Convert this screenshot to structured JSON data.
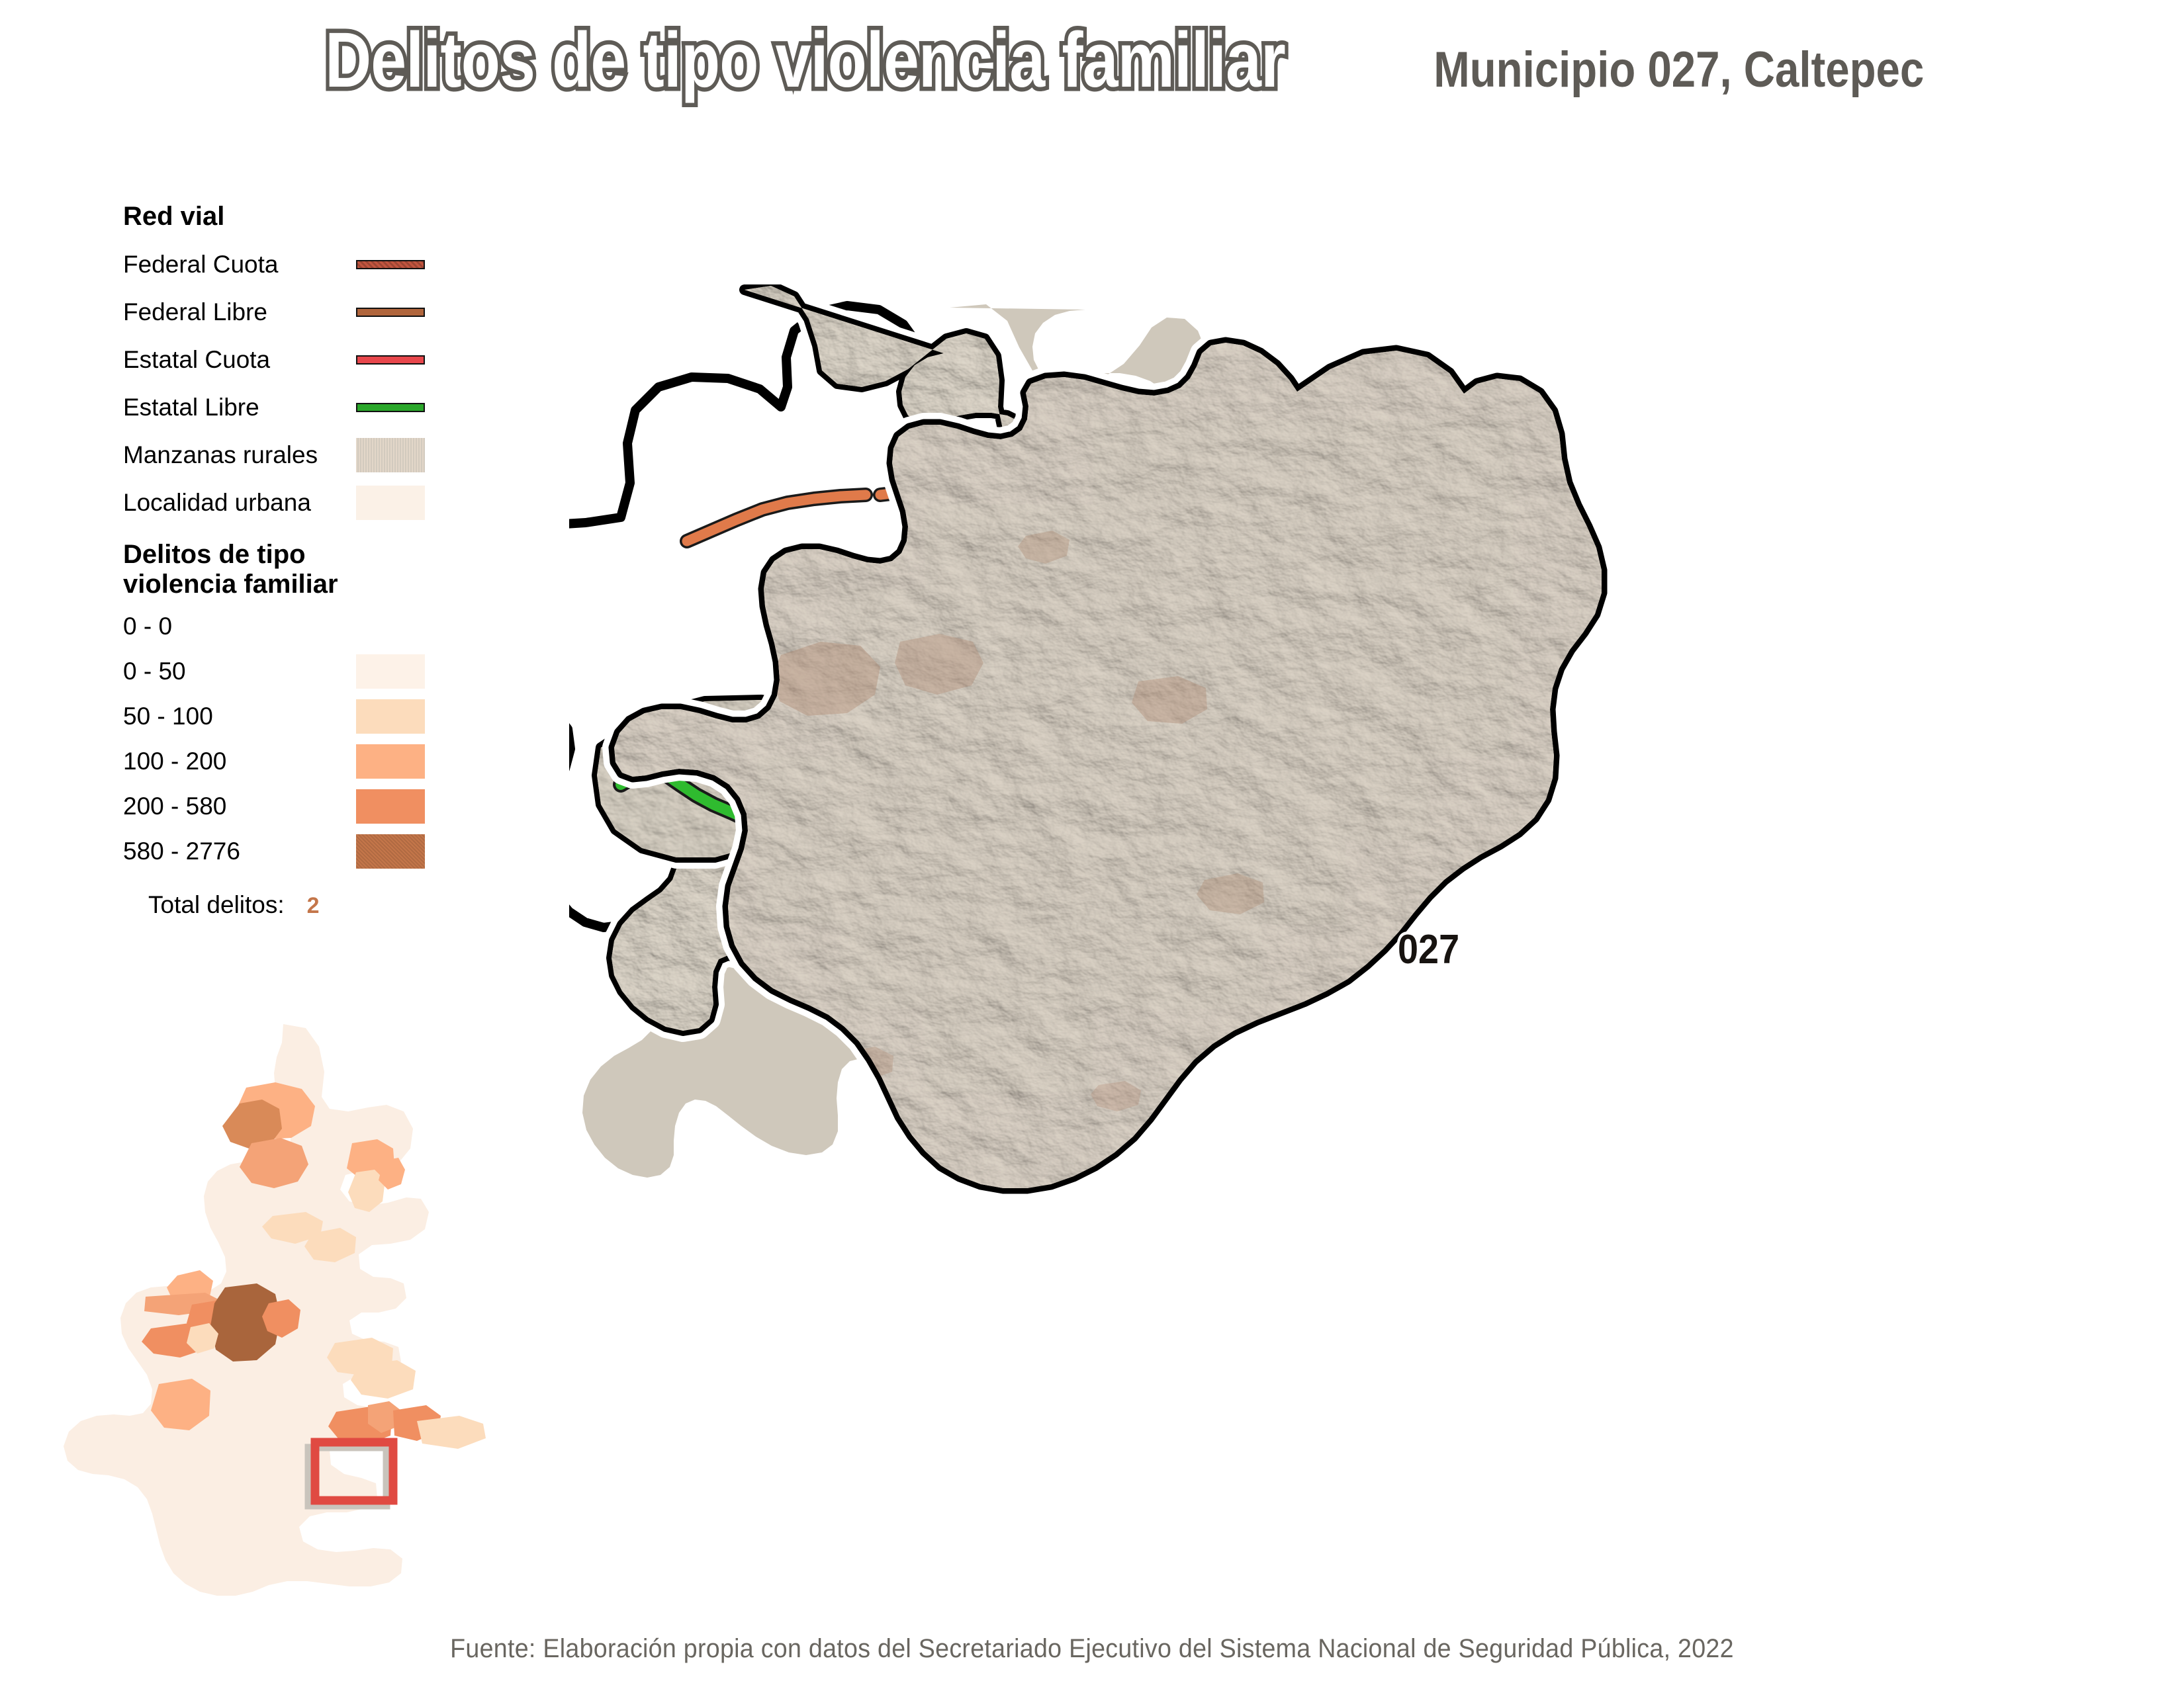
{
  "header": {
    "title": "Delitos de tipo violencia familiar",
    "subtitle": "Municipio 027, Caltepec"
  },
  "legend": {
    "roads_heading": "Red vial",
    "road_items": [
      {
        "label": "Federal Cuota",
        "color": "#c2553f",
        "pattern": "dithered"
      },
      {
        "label": "Federal Libre",
        "color": "#b0653c",
        "pattern": "solid"
      },
      {
        "label": "Estatal Cuota",
        "color": "#e8474c",
        "pattern": "solid"
      },
      {
        "label": "Estatal Libre",
        "color": "#2aa72a",
        "pattern": "solid"
      }
    ],
    "area_items": [
      {
        "label": "Manzanas rurales",
        "color": "#dcd0c4"
      },
      {
        "label": "Localidad urbana",
        "color": "#fbf1e7"
      }
    ],
    "classes_heading_line1": "Delitos de tipo",
    "classes_heading_line2": "violencia familiar",
    "classes": [
      {
        "label": "0 - 0",
        "color": "none"
      },
      {
        "label": "0 - 50",
        "color": "#fdf2e8"
      },
      {
        "label": "50 - 100",
        "color": "#fcdcbc"
      },
      {
        "label": "100 - 200",
        "color": "#fdb184"
      },
      {
        "label": "200 - 580",
        "color": "#f08f61"
      },
      {
        "label": "580 - 2776",
        "color": "#c4764a"
      }
    ],
    "total_label": "Total delitos:",
    "total_value": "2",
    "total_value_color": "#c4764a"
  },
  "map": {
    "municipality_code": "027",
    "terrain_base": "#cfc8bb",
    "terrain_shadow": "#9a9184",
    "boundary_color": "#000000",
    "boundary_halo": "#ffffff",
    "urban_fill": "#b0964f",
    "rural_fill": "#b08a72",
    "road_federal_libre": "#e07a4a",
    "road_estatal_libre": "#2fbb2f"
  },
  "inset": {
    "state_base": "#fbeee3",
    "locator_color": "#e04a42",
    "locator_shadow": "#c9c4bc",
    "highlight_colors": [
      "#fbeee3",
      "#fcdcbc",
      "#fdb184",
      "#f08f61",
      "#c4764a"
    ]
  },
  "footer": {
    "source": "Fuente: Elaboración propia con datos del Secretariado Ejecutivo del Sistema Nacional de Seguridad Pública, 2022"
  }
}
